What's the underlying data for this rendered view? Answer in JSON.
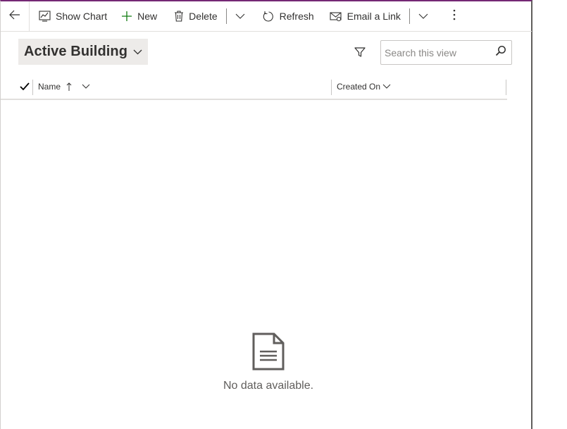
{
  "command_bar": {
    "back_icon": "back-arrow-icon",
    "show_chart": "Show Chart",
    "new": "New",
    "delete": "Delete",
    "refresh": "Refresh",
    "email_link": "Email a Link"
  },
  "view": {
    "title": "Active Building",
    "search_placeholder": "Search this view"
  },
  "grid": {
    "columns": [
      {
        "label": "Name",
        "sort": "ascending"
      },
      {
        "label": "Created On"
      }
    ],
    "rows": [],
    "empty_message": "No data available."
  },
  "colors": {
    "accent_top": "#742774",
    "new_plus": "#107c10",
    "header_bg": "#edebe9"
  }
}
